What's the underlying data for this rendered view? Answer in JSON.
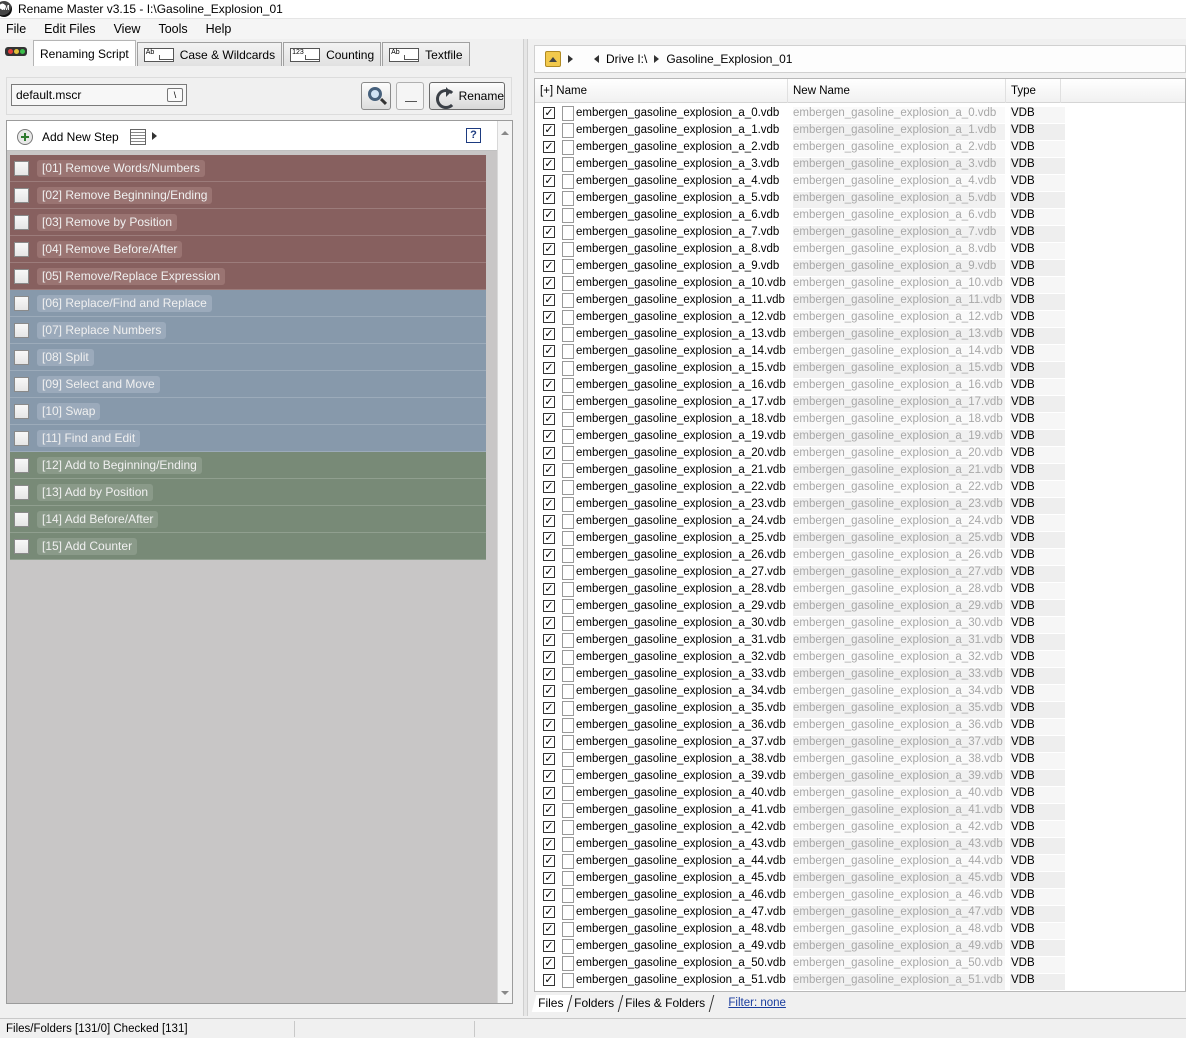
{
  "window": {
    "title": "Rename Master v3.15 - I:\\Gasoline_Explosion_01",
    "icon_text": "RM"
  },
  "menu": [
    "File",
    "Edit Files",
    "View",
    "Tools",
    "Help"
  ],
  "tabs": [
    {
      "label": "Renaming Script",
      "icon": "traffic-lights-icon"
    },
    {
      "label": "Case & Wildcards",
      "icon_text": "Ab"
    },
    {
      "label": "Counting",
      "icon_text": "123"
    },
    {
      "label": "Textfile",
      "icon_text": "Ab"
    }
  ],
  "script": {
    "file": "default.mscr",
    "rename_label": "Rename"
  },
  "steps_toolbar": {
    "add_label": "Add New Step",
    "help": "?"
  },
  "steps": [
    {
      "label": "[01]  Remove Words/Numbers",
      "group": "red"
    },
    {
      "label": "[02]  Remove Beginning/Ending",
      "group": "red"
    },
    {
      "label": "[03]  Remove by Position",
      "group": "red"
    },
    {
      "label": "[04]  Remove Before/After",
      "group": "red"
    },
    {
      "label": "[05]  Remove/Replace Expression",
      "group": "red"
    },
    {
      "label": "[06]  Replace/Find and Replace",
      "group": "blue"
    },
    {
      "label": "[07]  Replace Numbers",
      "group": "blue"
    },
    {
      "label": "[08]  Split",
      "group": "blue"
    },
    {
      "label": "[09]  Select and Move",
      "group": "blue"
    },
    {
      "label": "[10]  Swap",
      "group": "blue"
    },
    {
      "label": "[11]  Find and Edit",
      "group": "blue"
    },
    {
      "label": "[12]  Add to Beginning/Ending",
      "group": "green"
    },
    {
      "label": "[13]  Add by Position",
      "group": "green"
    },
    {
      "label": "[14]  Add Before/After",
      "group": "green"
    },
    {
      "label": "[15]  Add Counter",
      "group": "green"
    }
  ],
  "path": {
    "drive": "Drive I:\\",
    "folder": "Gasoline_Explosion_01"
  },
  "columns": {
    "name": "[+]  Name",
    "new_name": "New Name",
    "type": "Type"
  },
  "files": [
    {
      "name": "embergen_gasoline_explosion_a_0.vdb",
      "new_name": "embergen_gasoline_explosion_a_0.vdb",
      "type": "VDB"
    },
    {
      "name": "embergen_gasoline_explosion_a_1.vdb",
      "new_name": "embergen_gasoline_explosion_a_1.vdb",
      "type": "VDB"
    },
    {
      "name": "embergen_gasoline_explosion_a_2.vdb",
      "new_name": "embergen_gasoline_explosion_a_2.vdb",
      "type": "VDB"
    },
    {
      "name": "embergen_gasoline_explosion_a_3.vdb",
      "new_name": "embergen_gasoline_explosion_a_3.vdb",
      "type": "VDB"
    },
    {
      "name": "embergen_gasoline_explosion_a_4.vdb",
      "new_name": "embergen_gasoline_explosion_a_4.vdb",
      "type": "VDB"
    },
    {
      "name": "embergen_gasoline_explosion_a_5.vdb",
      "new_name": "embergen_gasoline_explosion_a_5.vdb",
      "type": "VDB"
    },
    {
      "name": "embergen_gasoline_explosion_a_6.vdb",
      "new_name": "embergen_gasoline_explosion_a_6.vdb",
      "type": "VDB"
    },
    {
      "name": "embergen_gasoline_explosion_a_7.vdb",
      "new_name": "embergen_gasoline_explosion_a_7.vdb",
      "type": "VDB"
    },
    {
      "name": "embergen_gasoline_explosion_a_8.vdb",
      "new_name": "embergen_gasoline_explosion_a_8.vdb",
      "type": "VDB"
    },
    {
      "name": "embergen_gasoline_explosion_a_9.vdb",
      "new_name": "embergen_gasoline_explosion_a_9.vdb",
      "type": "VDB"
    },
    {
      "name": "embergen_gasoline_explosion_a_10.vdb",
      "new_name": "embergen_gasoline_explosion_a_10.vdb",
      "type": "VDB"
    },
    {
      "name": "embergen_gasoline_explosion_a_11.vdb",
      "new_name": "embergen_gasoline_explosion_a_11.vdb",
      "type": "VDB"
    },
    {
      "name": "embergen_gasoline_explosion_a_12.vdb",
      "new_name": "embergen_gasoline_explosion_a_12.vdb",
      "type": "VDB"
    },
    {
      "name": "embergen_gasoline_explosion_a_13.vdb",
      "new_name": "embergen_gasoline_explosion_a_13.vdb",
      "type": "VDB"
    },
    {
      "name": "embergen_gasoline_explosion_a_14.vdb",
      "new_name": "embergen_gasoline_explosion_a_14.vdb",
      "type": "VDB"
    },
    {
      "name": "embergen_gasoline_explosion_a_15.vdb",
      "new_name": "embergen_gasoline_explosion_a_15.vdb",
      "type": "VDB"
    },
    {
      "name": "embergen_gasoline_explosion_a_16.vdb",
      "new_name": "embergen_gasoline_explosion_a_16.vdb",
      "type": "VDB"
    },
    {
      "name": "embergen_gasoline_explosion_a_17.vdb",
      "new_name": "embergen_gasoline_explosion_a_17.vdb",
      "type": "VDB"
    },
    {
      "name": "embergen_gasoline_explosion_a_18.vdb",
      "new_name": "embergen_gasoline_explosion_a_18.vdb",
      "type": "VDB"
    },
    {
      "name": "embergen_gasoline_explosion_a_19.vdb",
      "new_name": "embergen_gasoline_explosion_a_19.vdb",
      "type": "VDB"
    },
    {
      "name": "embergen_gasoline_explosion_a_20.vdb",
      "new_name": "embergen_gasoline_explosion_a_20.vdb",
      "type": "VDB"
    },
    {
      "name": "embergen_gasoline_explosion_a_21.vdb",
      "new_name": "embergen_gasoline_explosion_a_21.vdb",
      "type": "VDB"
    },
    {
      "name": "embergen_gasoline_explosion_a_22.vdb",
      "new_name": "embergen_gasoline_explosion_a_22.vdb",
      "type": "VDB"
    },
    {
      "name": "embergen_gasoline_explosion_a_23.vdb",
      "new_name": "embergen_gasoline_explosion_a_23.vdb",
      "type": "VDB"
    },
    {
      "name": "embergen_gasoline_explosion_a_24.vdb",
      "new_name": "embergen_gasoline_explosion_a_24.vdb",
      "type": "VDB"
    },
    {
      "name": "embergen_gasoline_explosion_a_25.vdb",
      "new_name": "embergen_gasoline_explosion_a_25.vdb",
      "type": "VDB"
    },
    {
      "name": "embergen_gasoline_explosion_a_26.vdb",
      "new_name": "embergen_gasoline_explosion_a_26.vdb",
      "type": "VDB"
    },
    {
      "name": "embergen_gasoline_explosion_a_27.vdb",
      "new_name": "embergen_gasoline_explosion_a_27.vdb",
      "type": "VDB"
    },
    {
      "name": "embergen_gasoline_explosion_a_28.vdb",
      "new_name": "embergen_gasoline_explosion_a_28.vdb",
      "type": "VDB"
    },
    {
      "name": "embergen_gasoline_explosion_a_29.vdb",
      "new_name": "embergen_gasoline_explosion_a_29.vdb",
      "type": "VDB"
    },
    {
      "name": "embergen_gasoline_explosion_a_30.vdb",
      "new_name": "embergen_gasoline_explosion_a_30.vdb",
      "type": "VDB"
    },
    {
      "name": "embergen_gasoline_explosion_a_31.vdb",
      "new_name": "embergen_gasoline_explosion_a_31.vdb",
      "type": "VDB"
    },
    {
      "name": "embergen_gasoline_explosion_a_32.vdb",
      "new_name": "embergen_gasoline_explosion_a_32.vdb",
      "type": "VDB"
    },
    {
      "name": "embergen_gasoline_explosion_a_33.vdb",
      "new_name": "embergen_gasoline_explosion_a_33.vdb",
      "type": "VDB"
    },
    {
      "name": "embergen_gasoline_explosion_a_34.vdb",
      "new_name": "embergen_gasoline_explosion_a_34.vdb",
      "type": "VDB"
    },
    {
      "name": "embergen_gasoline_explosion_a_35.vdb",
      "new_name": "embergen_gasoline_explosion_a_35.vdb",
      "type": "VDB"
    },
    {
      "name": "embergen_gasoline_explosion_a_36.vdb",
      "new_name": "embergen_gasoline_explosion_a_36.vdb",
      "type": "VDB"
    },
    {
      "name": "embergen_gasoline_explosion_a_37.vdb",
      "new_name": "embergen_gasoline_explosion_a_37.vdb",
      "type": "VDB"
    },
    {
      "name": "embergen_gasoline_explosion_a_38.vdb",
      "new_name": "embergen_gasoline_explosion_a_38.vdb",
      "type": "VDB"
    },
    {
      "name": "embergen_gasoline_explosion_a_39.vdb",
      "new_name": "embergen_gasoline_explosion_a_39.vdb",
      "type": "VDB"
    },
    {
      "name": "embergen_gasoline_explosion_a_40.vdb",
      "new_name": "embergen_gasoline_explosion_a_40.vdb",
      "type": "VDB"
    },
    {
      "name": "embergen_gasoline_explosion_a_41.vdb",
      "new_name": "embergen_gasoline_explosion_a_41.vdb",
      "type": "VDB"
    },
    {
      "name": "embergen_gasoline_explosion_a_42.vdb",
      "new_name": "embergen_gasoline_explosion_a_42.vdb",
      "type": "VDB"
    },
    {
      "name": "embergen_gasoline_explosion_a_43.vdb",
      "new_name": "embergen_gasoline_explosion_a_43.vdb",
      "type": "VDB"
    },
    {
      "name": "embergen_gasoline_explosion_a_44.vdb",
      "new_name": "embergen_gasoline_explosion_a_44.vdb",
      "type": "VDB"
    },
    {
      "name": "embergen_gasoline_explosion_a_45.vdb",
      "new_name": "embergen_gasoline_explosion_a_45.vdb",
      "type": "VDB"
    },
    {
      "name": "embergen_gasoline_explosion_a_46.vdb",
      "new_name": "embergen_gasoline_explosion_a_46.vdb",
      "type": "VDB"
    },
    {
      "name": "embergen_gasoline_explosion_a_47.vdb",
      "new_name": "embergen_gasoline_explosion_a_47.vdb",
      "type": "VDB"
    },
    {
      "name": "embergen_gasoline_explosion_a_48.vdb",
      "new_name": "embergen_gasoline_explosion_a_48.vdb",
      "type": "VDB"
    },
    {
      "name": "embergen_gasoline_explosion_a_49.vdb",
      "new_name": "embergen_gasoline_explosion_a_49.vdb",
      "type": "VDB"
    },
    {
      "name": "embergen_gasoline_explosion_a_50.vdb",
      "new_name": "embergen_gasoline_explosion_a_50.vdb",
      "type": "VDB"
    },
    {
      "name": "embergen_gasoline_explosion_a_51.vdb",
      "new_name": "embergen_gasoline_explosion_a_51.vdb",
      "type": "VDB"
    }
  ],
  "bottom_tabs": [
    "Files",
    "Folders",
    "Files & Folders"
  ],
  "filter": "Filter:  none",
  "status": {
    "text": "Files/Folders [131/0] Checked [131]"
  },
  "colors": {
    "remove_group": "#87605f",
    "replace_group": "#8799ab",
    "add_group": "#788a77",
    "new_name_text": "#a8a8a8"
  }
}
